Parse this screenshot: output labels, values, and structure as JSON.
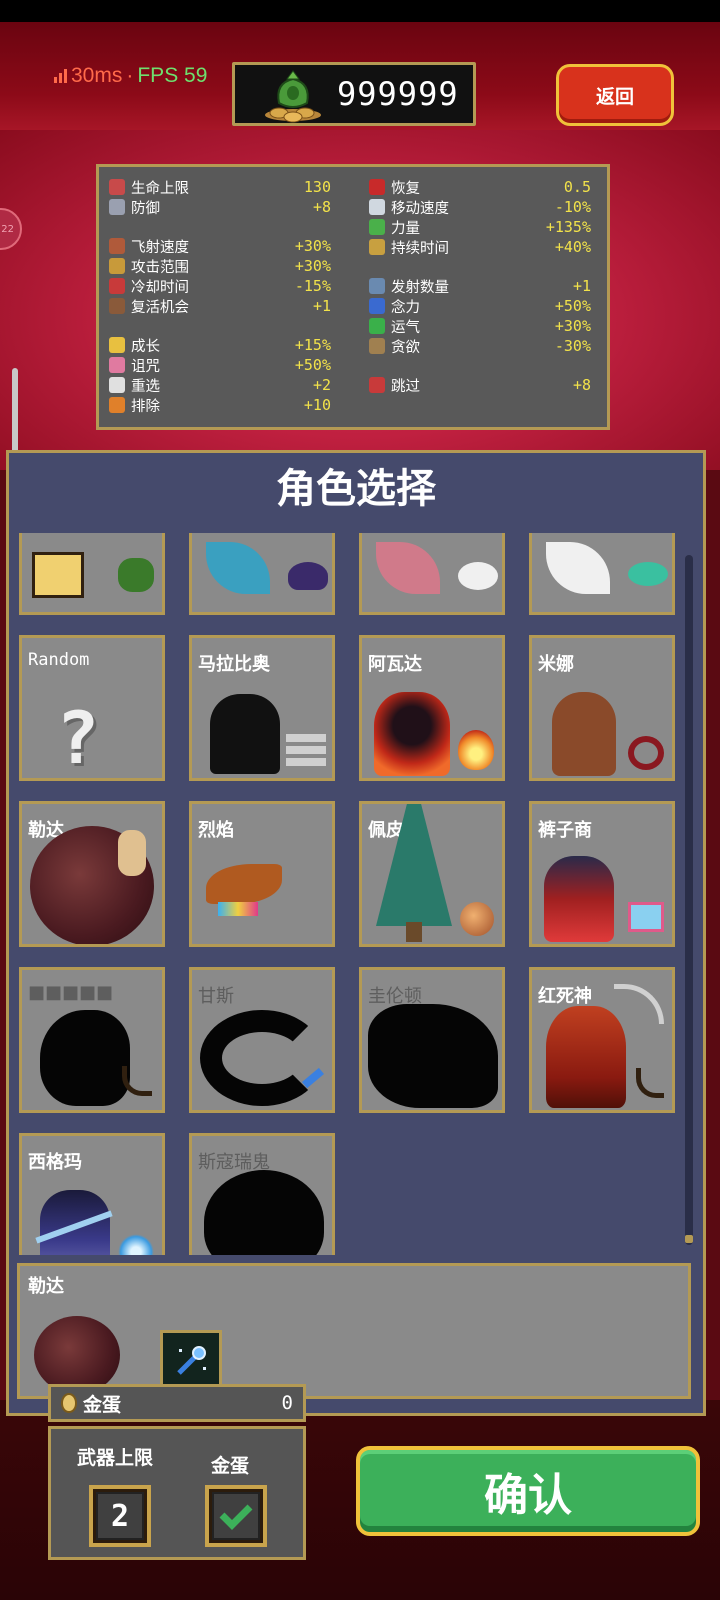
{
  "status": {
    "ping": "30ms",
    "separator": "·",
    "fps": "FPS 59"
  },
  "currency": {
    "amount": "999999",
    "icon": "money-bag-icon"
  },
  "back_button": "返回",
  "stats": {
    "left": [
      {
        "label": "生命上限",
        "value": "130",
        "icon": "heart-icon",
        "color": "#c84a4a"
      },
      {
        "label": "防御",
        "value": "+8",
        "icon": "armor-icon",
        "color": "#9aa0b0"
      },
      {
        "label": "飞射速度",
        "value": "+30%",
        "icon": "speed-icon",
        "color": "#b05a3a",
        "gap": true
      },
      {
        "label": "攻击范围",
        "value": "+30%",
        "icon": "area-icon",
        "color": "#c89a3a"
      },
      {
        "label": "冷却时间",
        "value": "-15%",
        "icon": "cooldown-icon",
        "color": "#c83a3a"
      },
      {
        "label": "复活机会",
        "value": "+1",
        "icon": "revival-icon",
        "color": "#8a5a3a"
      },
      {
        "label": "成长",
        "value": "+15%",
        "icon": "crown-icon",
        "color": "#e8c040",
        "gap": true
      },
      {
        "label": "诅咒",
        "value": "+50%",
        "icon": "skull-icon",
        "color": "#e07aa0"
      },
      {
        "label": "重选",
        "value": "+2",
        "icon": "dice-icon",
        "color": "#e0e0e0"
      },
      {
        "label": "排除",
        "value": "+10",
        "icon": "banish-icon",
        "color": "#e0802a"
      }
    ],
    "right": [
      {
        "label": "恢复",
        "value": "0.5",
        "icon": "recovery-heart-icon",
        "color": "#c82a2a"
      },
      {
        "label": "移动速度",
        "value": "-10%",
        "icon": "wing-icon",
        "color": "#d0d8e0"
      },
      {
        "label": "力量",
        "value": "+135%",
        "icon": "feather-icon",
        "color": "#4ab04a"
      },
      {
        "label": "持续时间",
        "value": "+40%",
        "icon": "hourglass-icon",
        "color": "#c8a040"
      },
      {
        "label": "发射数量",
        "value": "+1",
        "icon": "amount-icon",
        "color": "#6a8ab0",
        "gap": true
      },
      {
        "label": "念力",
        "value": "+50%",
        "icon": "orb-icon",
        "color": "#3a6ad0"
      },
      {
        "label": "运气",
        "value": "+30%",
        "icon": "clover-icon",
        "color": "#3ab04a"
      },
      {
        "label": "贪欲",
        "value": "-30%",
        "icon": "greed-icon",
        "color": "#a08050"
      },
      {
        "label": "跳过",
        "value": "+8",
        "icon": "skip-icon",
        "color": "#c83a3a",
        "gap2": true
      }
    ]
  },
  "panel_title": "角色选择",
  "characters": [
    {
      "name": "Random",
      "locked": false
    },
    {
      "name": "马拉比奥",
      "locked": false
    },
    {
      "name": "阿瓦达",
      "locked": false
    },
    {
      "name": "米娜",
      "locked": false
    },
    {
      "name": "勒达",
      "locked": false
    },
    {
      "name": "烈焰",
      "locked": false
    },
    {
      "name": "佩皮诺",
      "locked": false
    },
    {
      "name": "裤子商",
      "locked": false
    },
    {
      "name": "■■■■■",
      "locked": true
    },
    {
      "name": "甘斯",
      "locked": true
    },
    {
      "name": "圭伦顿",
      "locked": true
    },
    {
      "name": "红死神",
      "locked": false
    },
    {
      "name": "西格玛",
      "locked": false
    },
    {
      "name": "斯寇瑞鬼",
      "locked": true
    }
  ],
  "selected": {
    "name": "勒达",
    "weapon_icon": "magic-wand-icon"
  },
  "egg": {
    "label": "金蛋",
    "count": "0"
  },
  "options": {
    "weapon_limit_label": "武器上限",
    "weapon_limit_value": "2",
    "golden_egg_label": "金蛋",
    "golden_egg_checked": true
  },
  "confirm_button": "确认"
}
